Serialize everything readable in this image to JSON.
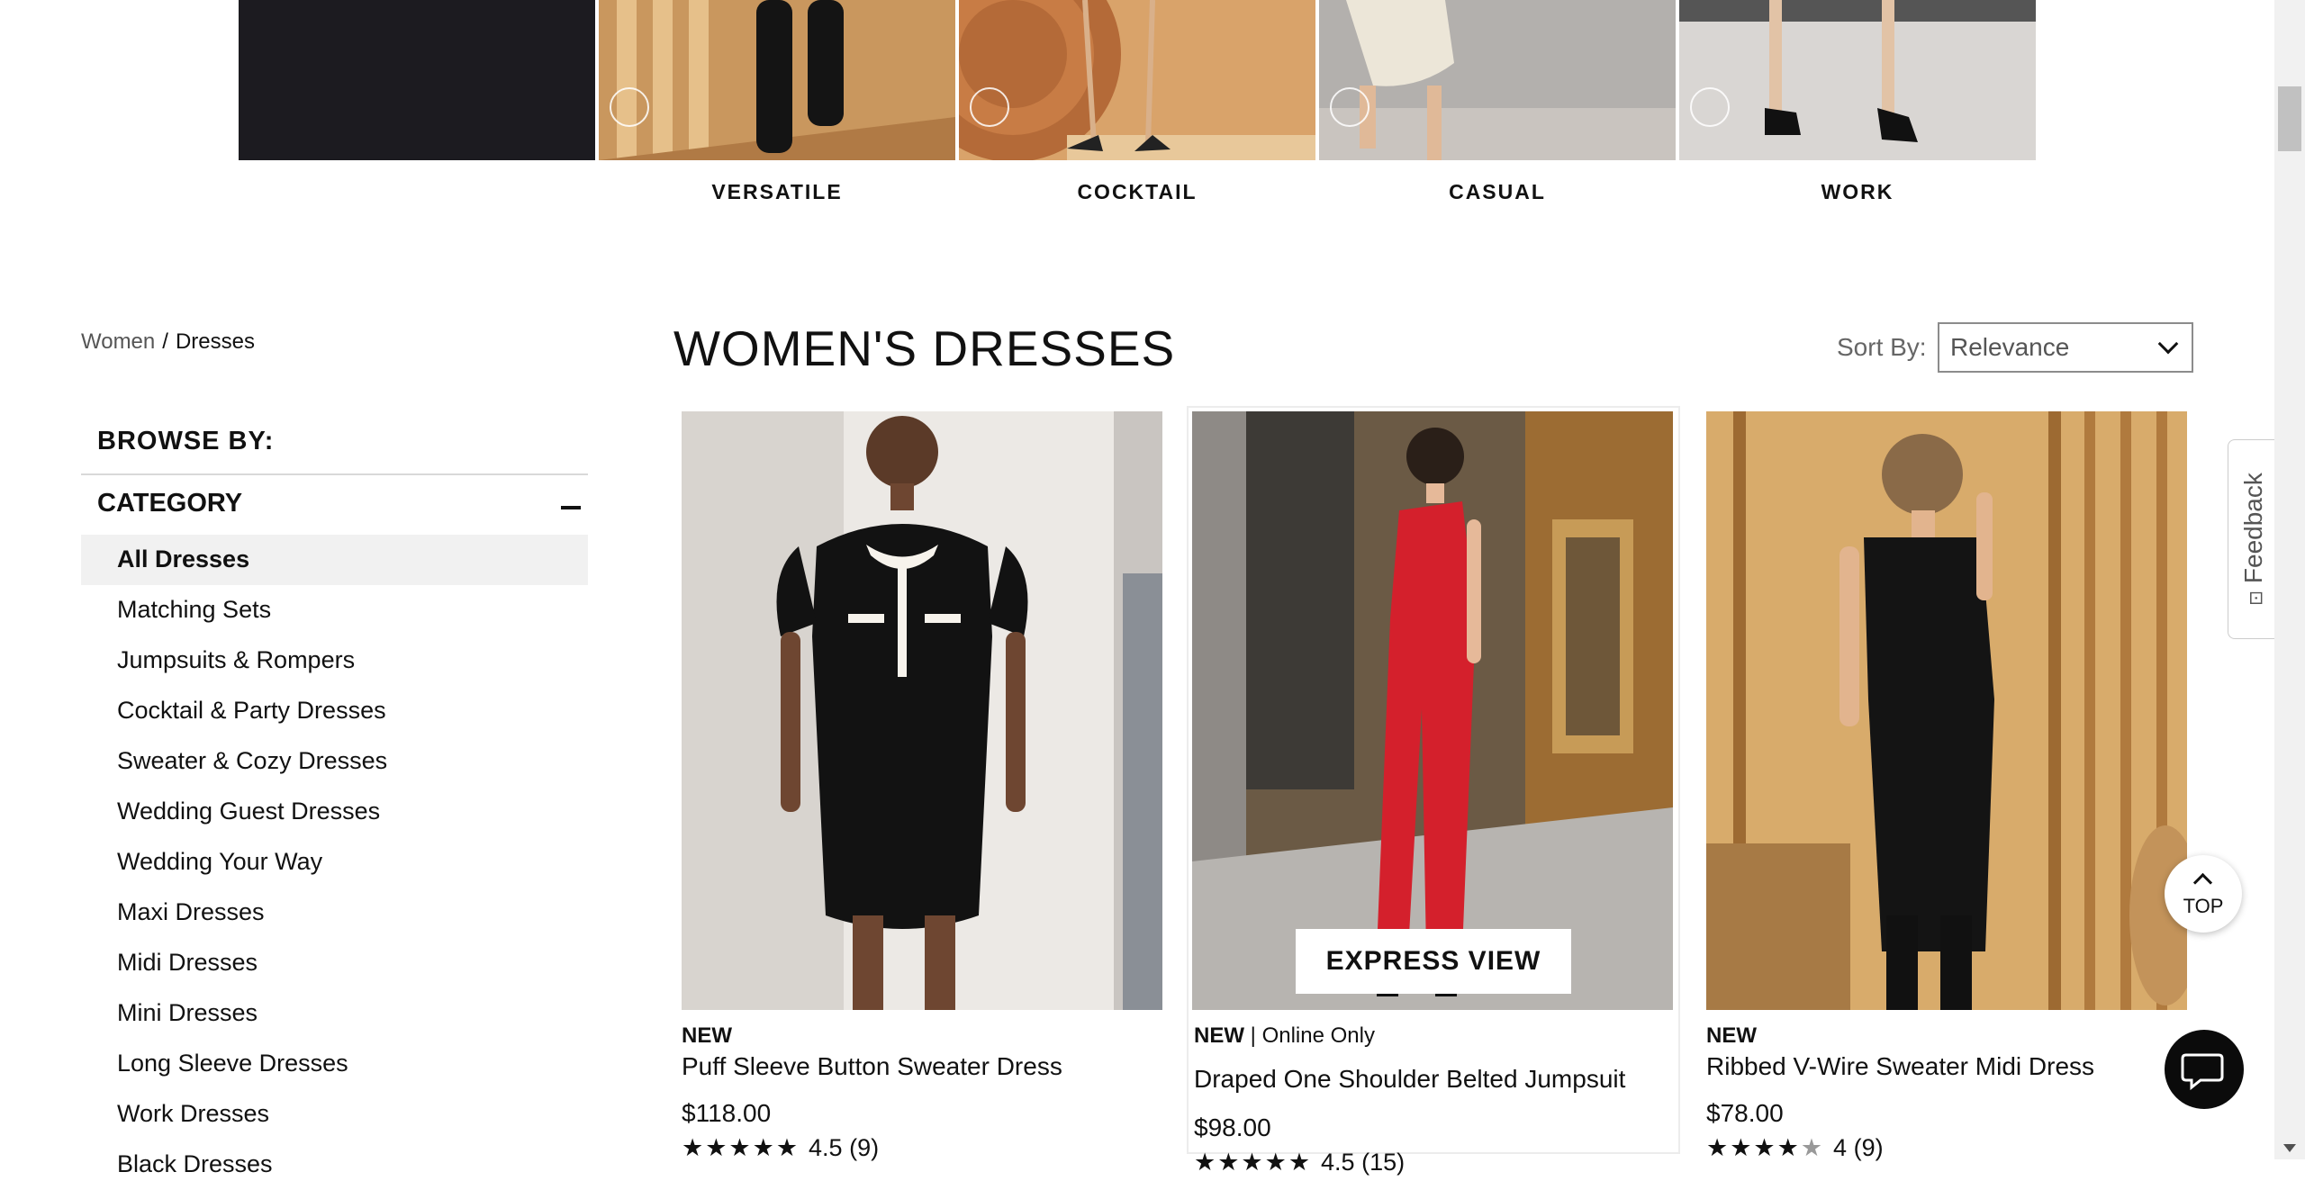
{
  "categories_strip": {
    "tiles": [
      {
        "label": ""
      },
      {
        "label": "VERSATILE"
      },
      {
        "label": "COCKTAIL"
      },
      {
        "label": "CASUAL"
      },
      {
        "label": "WORK"
      }
    ]
  },
  "breadcrumb": {
    "items": [
      "Women",
      "Dresses"
    ],
    "separator": "/"
  },
  "sidebar": {
    "browse_title": "BROWSE BY:",
    "category_heading": "CATEGORY",
    "items": [
      {
        "label": "All Dresses",
        "active": true
      },
      {
        "label": "Matching Sets"
      },
      {
        "label": "Jumpsuits & Rompers"
      },
      {
        "label": "Cocktail & Party Dresses"
      },
      {
        "label": "Sweater & Cozy Dresses"
      },
      {
        "label": "Wedding Guest Dresses"
      },
      {
        "label": "Wedding Your Way"
      },
      {
        "label": "Maxi Dresses"
      },
      {
        "label": "Midi Dresses"
      },
      {
        "label": "Mini Dresses"
      },
      {
        "label": "Long Sleeve Dresses"
      },
      {
        "label": "Work Dresses"
      },
      {
        "label": "Black Dresses"
      }
    ]
  },
  "main": {
    "title": "WOMEN'S DRESSES",
    "sort_label": "Sort By:",
    "sort_value": "Relevance"
  },
  "products": [
    {
      "badge": "NEW",
      "online_only": "",
      "name": "Puff Sleeve Button Sweater Dress",
      "price": "$118.00",
      "stars": "★★★★★",
      "rating": "4.5",
      "reviews": "(9)"
    },
    {
      "badge": "NEW",
      "online_only": "| Online Only",
      "name": "Draped One Shoulder Belted Jumpsuit",
      "price": "$98.00",
      "stars": "★★★★★",
      "rating": "4.5",
      "reviews": "(15)",
      "express_view": "EXPRESS VIEW"
    },
    {
      "badge": "NEW",
      "online_only": "",
      "name": "Ribbed V-Wire Sweater Midi Dress",
      "price": "$78.00",
      "stars": "★★★★",
      "star_empty": "★",
      "rating": "4",
      "reviews": "(9)"
    }
  ],
  "widgets": {
    "feedback": "Feedback",
    "top": "TOP"
  },
  "colors": {
    "accent_dark": "#1c1b20",
    "active_bg": "#f1f1f1",
    "jumpsuit_red": "#d4202c"
  }
}
